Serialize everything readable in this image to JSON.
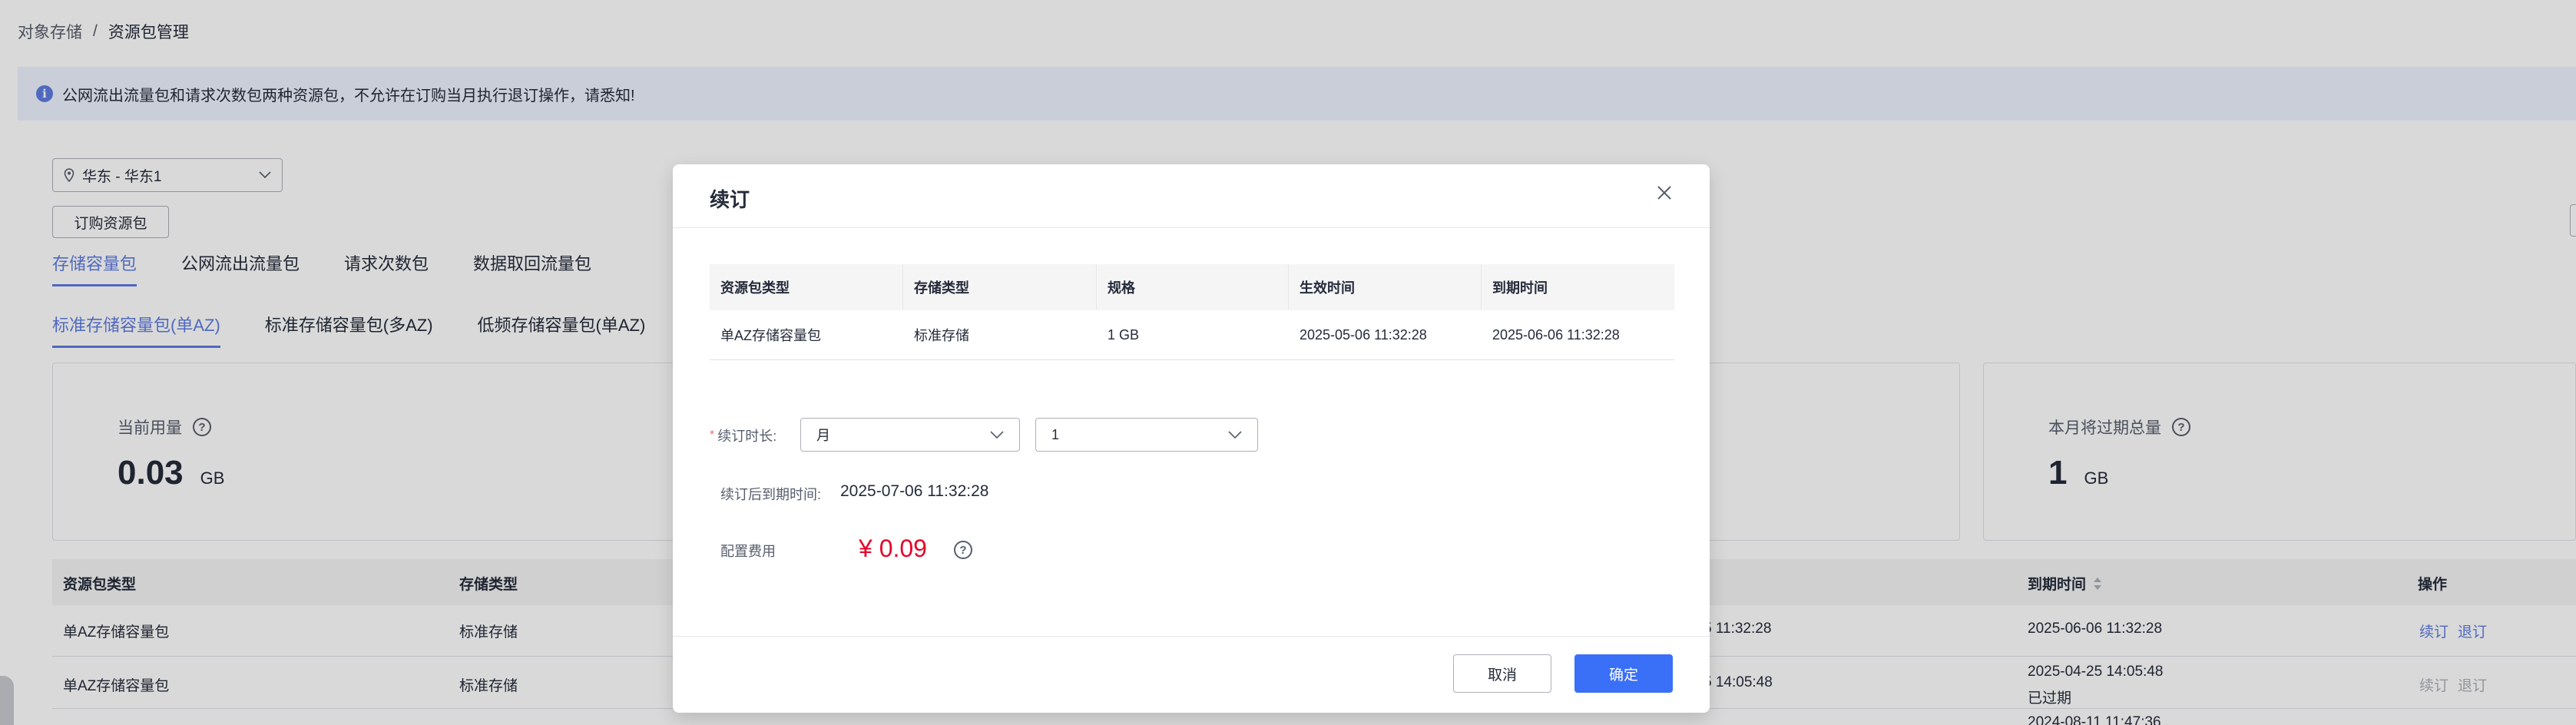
{
  "breadcrumb": {
    "root": "对象存储",
    "sep": "/",
    "current": "资源包管理"
  },
  "notice": {
    "icon": "info-icon",
    "text": "公网流出流量包和请求次数包两种资源包，不允许在订购当月执行退订操作，请悉知!"
  },
  "region": {
    "icon": "location-pin-icon",
    "value": "华东 - 华东1"
  },
  "buy_button": "订购资源包",
  "tabs_primary": [
    "存储容量包",
    "公网流出流量包",
    "请求次数包",
    "数据取回流量包"
  ],
  "tabs_secondary": [
    "标准存储容量包(单AZ)",
    "标准存储容量包(多AZ)",
    "低频存储容量包(单AZ)"
  ],
  "cards": {
    "current": {
      "label": "当前用量",
      "value": "0.03",
      "unit": "GB"
    },
    "expiring": {
      "label": "本月将过期总量",
      "value": "1",
      "unit": "GB"
    }
  },
  "bg_table": {
    "headers": {
      "type": "资源包类型",
      "storage": "存储类型",
      "expire": "到期时间",
      "ops": "操作"
    },
    "rows": [
      {
        "type": "单AZ存储容量包",
        "storage": "标准存储",
        "partial": "5 11:32:28",
        "expire": "2025-06-06 11:32:28",
        "status": "",
        "op1": "续订",
        "op2": "退订",
        "enabled": true
      },
      {
        "type": "单AZ存储容量包",
        "storage": "标准存储",
        "partial": "5 14:05:48",
        "expire": "2025-04-25 14:05:48",
        "status": "已过期",
        "op1": "续订",
        "op2": "退订",
        "enabled": false
      },
      {
        "type": "",
        "storage": "",
        "partial": "",
        "expire": "2024-08-11 11:47:36",
        "status": "",
        "op1": "",
        "op2": "",
        "enabled": false
      }
    ]
  },
  "modal": {
    "title": "续订",
    "table_headers": [
      "资源包类型",
      "存储类型",
      "规格",
      "生效时间",
      "到期时间"
    ],
    "table_row": [
      "单AZ存储容量包",
      "标准存储",
      "1 GB",
      "2025-05-06 11:32:28",
      "2025-06-06 11:32:28"
    ],
    "duration_label": "续订时长:",
    "duration_unit": "月",
    "duration_value": "1",
    "new_expire_label": "续订后到期时间:",
    "new_expire_value": "2025-07-06 11:32:28",
    "fee_label": "配置费用",
    "fee_value": "¥ 0.09",
    "cancel": "取消",
    "confirm": "确定"
  },
  "colors": {
    "accent": "#5e7ce0",
    "primary_button": "#3a6ff7",
    "price": "#e5052a"
  }
}
